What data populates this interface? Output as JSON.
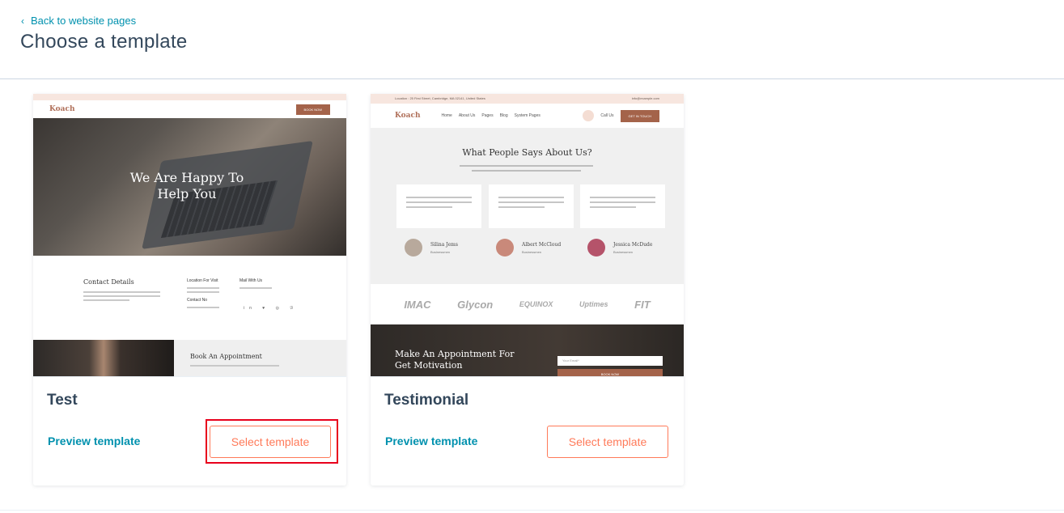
{
  "header": {
    "back_label": "Back to website pages",
    "title": "Choose a template"
  },
  "templates": [
    {
      "name": "Test",
      "preview_label": "Preview template",
      "select_label": "Select template",
      "thumbnail": {
        "logo": "Koach",
        "hero_text": "We Are Happy To Help You",
        "contact_title": "Contact Details",
        "location_label": "Location For Visit",
        "mail_label": "Mail With Us",
        "contact_label": "Contact No",
        "book_button": "BOOK NOW",
        "appointment_title": "Book An Appointment"
      }
    },
    {
      "name": "Testimonial",
      "preview_label": "Preview template",
      "select_label": "Select template",
      "thumbnail": {
        "logo": "Koach",
        "top_location": "Location : 25 First Street, Cambridge, MA 02141, United States",
        "top_email": "info@example.com",
        "nav": [
          "Home",
          "About Us",
          "Pages",
          "Blog",
          "System Pages"
        ],
        "call_label": "Call Us",
        "get_in_touch": "GET IN TOUCH",
        "section_title": "What People Says About Us?",
        "people": [
          {
            "name": "Silina Jems",
            "role": "Businessmen"
          },
          {
            "name": "Albert McCloud",
            "role": "Businessmen"
          },
          {
            "name": "Jessica McDude",
            "role": "Businessmen"
          }
        ],
        "logos": [
          "IMAC",
          "Glycon",
          "EQUINOX",
          "Uptimes",
          "FIT"
        ],
        "cta_text": "Make An Appointment For Get Motivation",
        "email_placeholder": "Your Email*",
        "book_button": "BOOK NOW"
      }
    }
  ]
}
